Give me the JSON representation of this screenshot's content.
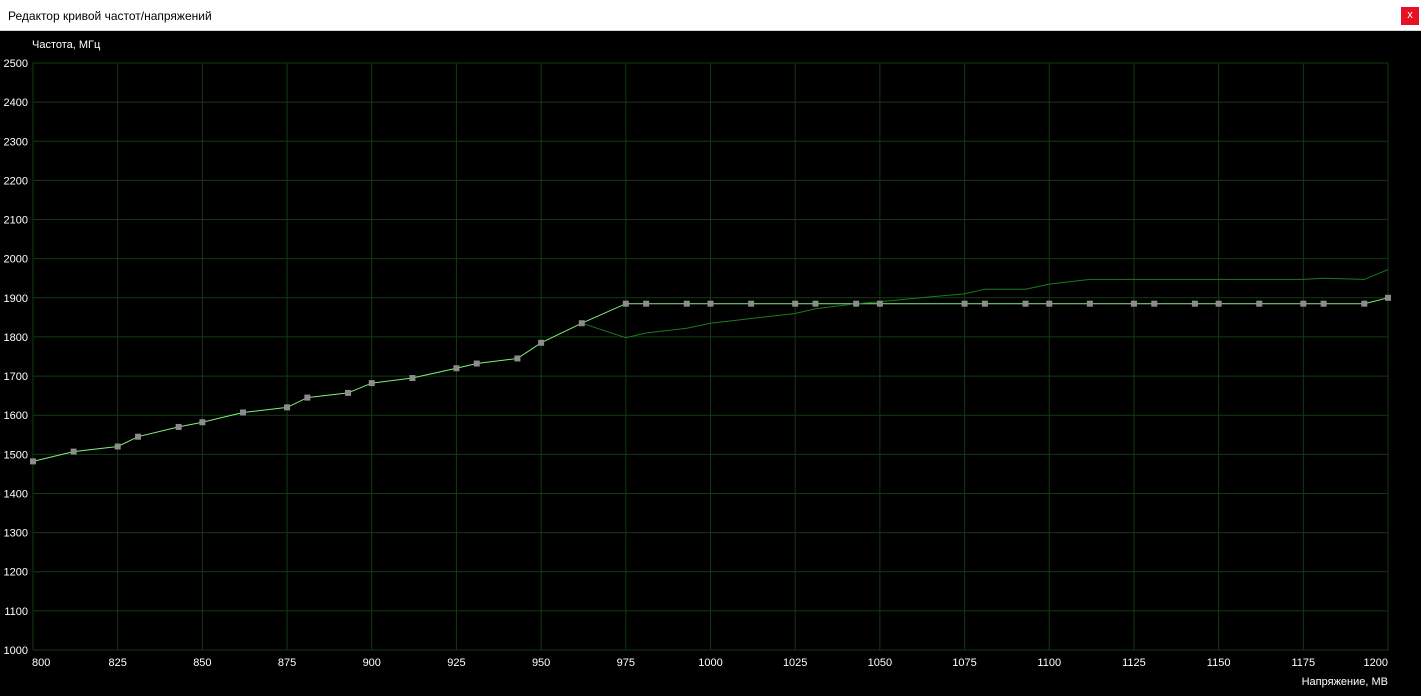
{
  "window": {
    "title": "Редактор кривой частот/напряжений",
    "close_label": "x"
  },
  "chart_data": {
    "type": "line",
    "ylabel": "Частота, МГц",
    "xlabel": "Напряжение, МВ",
    "xlim": [
      800,
      1200
    ],
    "ylim": [
      1000,
      2500
    ],
    "x_ticks": [
      800,
      825,
      850,
      875,
      900,
      925,
      950,
      975,
      1000,
      1025,
      1050,
      1075,
      1100,
      1125,
      1150,
      1175,
      1200
    ],
    "y_ticks": [
      1000,
      1100,
      1200,
      1300,
      1400,
      1500,
      1600,
      1700,
      1800,
      1900,
      2000,
      2100,
      2200,
      2300,
      2400,
      2500
    ],
    "grid": true,
    "colors": {
      "curve": "#7cf27c",
      "default_curve": "#1c7a1c",
      "point": "#8c8c8c",
      "grid": "#123a12"
    },
    "series": [
      {
        "role": "edited-curve",
        "x": [
          800,
          812,
          825,
          831,
          843,
          850,
          862,
          875,
          881,
          893,
          900,
          912,
          925,
          931,
          943,
          950,
          962,
          975,
          981,
          993,
          1000,
          1012,
          1025,
          1031,
          1043,
          1050,
          1075,
          1081,
          1093,
          1100,
          1112,
          1125,
          1131,
          1143,
          1150,
          1162,
          1175,
          1181,
          1193,
          1200
        ],
        "y": [
          1482,
          1507,
          1520,
          1545,
          1570,
          1582,
          1607,
          1620,
          1645,
          1657,
          1682,
          1695,
          1720,
          1732,
          1745,
          1785,
          1835,
          1885,
          1885,
          1885,
          1885,
          1885,
          1885,
          1885,
          1885,
          1885,
          1885,
          1885,
          1885,
          1885,
          1885,
          1885,
          1885,
          1885,
          1885,
          1885,
          1885,
          1885,
          1885,
          1900
        ]
      },
      {
        "role": "default-curve",
        "x": [
          962,
          975,
          981,
          993,
          1000,
          1012,
          1025,
          1031,
          1043,
          1050,
          1062,
          1075,
          1081,
          1093,
          1100,
          1112,
          1125,
          1143,
          1162,
          1175,
          1181,
          1193,
          1200
        ],
        "y": [
          1835,
          1798,
          1810,
          1822,
          1835,
          1847,
          1860,
          1872,
          1885,
          1890,
          1900,
          1910,
          1922,
          1922,
          1935,
          1947,
          1947,
          1947,
          1947,
          1947,
          1950,
          1947,
          1972
        ]
      }
    ]
  }
}
